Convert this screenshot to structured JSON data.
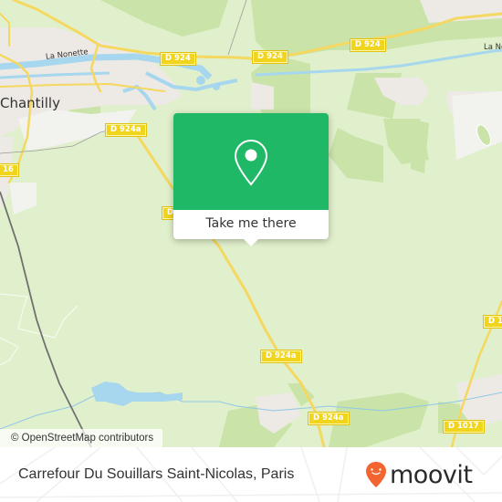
{
  "map": {
    "place_labels": {
      "town": "Chantilly",
      "river": "La Nonette",
      "river_east": "La No"
    },
    "road_labels": {
      "d924_a": "D 924",
      "d924_b": "D 924",
      "d924_c": "D 924",
      "d924a_north": "D 924a",
      "d924a_mid": "D 924a",
      "d924a_south": "D 924a",
      "d1017": "D 1017",
      "d1017_partial": "D 1",
      "d16_partial": "16",
      "d924a_partial": "D"
    },
    "attribution": "© OpenStreetMap contributors",
    "colors": {
      "land": "#e1f0cc",
      "forest": "#c9e3a8",
      "urban": "#ede9e4",
      "water": "#a6d7ee",
      "road": "#f4d860",
      "road_label_bg": "#f1d51c",
      "rail": "#707070"
    }
  },
  "popup": {
    "icon": "map-pin-icon",
    "button_label": "Take me there",
    "color": "#1fb866"
  },
  "footer": {
    "title": "Carrefour Du Souillars Saint-Nicolas, Paris",
    "logo_text": "moovit",
    "logo_icon": "moovit-smiley-pin-icon",
    "logo_color": "#f26430"
  }
}
